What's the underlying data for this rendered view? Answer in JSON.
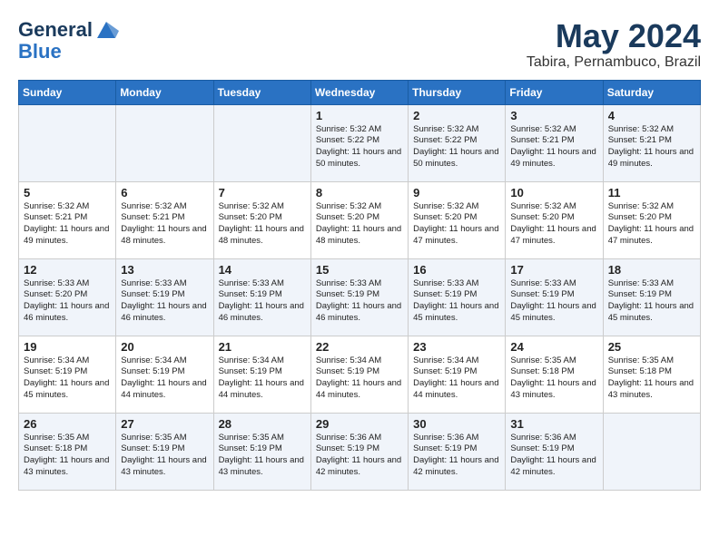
{
  "header": {
    "logo_line1": "General",
    "logo_line2": "Blue",
    "month": "May 2024",
    "location": "Tabira, Pernambuco, Brazil"
  },
  "days_of_week": [
    "Sunday",
    "Monday",
    "Tuesday",
    "Wednesday",
    "Thursday",
    "Friday",
    "Saturday"
  ],
  "weeks": [
    [
      {
        "day": "",
        "content": ""
      },
      {
        "day": "",
        "content": ""
      },
      {
        "day": "",
        "content": ""
      },
      {
        "day": "1",
        "content": "Sunrise: 5:32 AM\nSunset: 5:22 PM\nDaylight: 11 hours\nand 50 minutes."
      },
      {
        "day": "2",
        "content": "Sunrise: 5:32 AM\nSunset: 5:22 PM\nDaylight: 11 hours\nand 50 minutes."
      },
      {
        "day": "3",
        "content": "Sunrise: 5:32 AM\nSunset: 5:21 PM\nDaylight: 11 hours\nand 49 minutes."
      },
      {
        "day": "4",
        "content": "Sunrise: 5:32 AM\nSunset: 5:21 PM\nDaylight: 11 hours\nand 49 minutes."
      }
    ],
    [
      {
        "day": "5",
        "content": "Sunrise: 5:32 AM\nSunset: 5:21 PM\nDaylight: 11 hours\nand 49 minutes."
      },
      {
        "day": "6",
        "content": "Sunrise: 5:32 AM\nSunset: 5:21 PM\nDaylight: 11 hours\nand 48 minutes."
      },
      {
        "day": "7",
        "content": "Sunrise: 5:32 AM\nSunset: 5:20 PM\nDaylight: 11 hours\nand 48 minutes."
      },
      {
        "day": "8",
        "content": "Sunrise: 5:32 AM\nSunset: 5:20 PM\nDaylight: 11 hours\nand 48 minutes."
      },
      {
        "day": "9",
        "content": "Sunrise: 5:32 AM\nSunset: 5:20 PM\nDaylight: 11 hours\nand 47 minutes."
      },
      {
        "day": "10",
        "content": "Sunrise: 5:32 AM\nSunset: 5:20 PM\nDaylight: 11 hours\nand 47 minutes."
      },
      {
        "day": "11",
        "content": "Sunrise: 5:32 AM\nSunset: 5:20 PM\nDaylight: 11 hours\nand 47 minutes."
      }
    ],
    [
      {
        "day": "12",
        "content": "Sunrise: 5:33 AM\nSunset: 5:20 PM\nDaylight: 11 hours\nand 46 minutes."
      },
      {
        "day": "13",
        "content": "Sunrise: 5:33 AM\nSunset: 5:19 PM\nDaylight: 11 hours\nand 46 minutes."
      },
      {
        "day": "14",
        "content": "Sunrise: 5:33 AM\nSunset: 5:19 PM\nDaylight: 11 hours\nand 46 minutes."
      },
      {
        "day": "15",
        "content": "Sunrise: 5:33 AM\nSunset: 5:19 PM\nDaylight: 11 hours\nand 46 minutes."
      },
      {
        "day": "16",
        "content": "Sunrise: 5:33 AM\nSunset: 5:19 PM\nDaylight: 11 hours\nand 45 minutes."
      },
      {
        "day": "17",
        "content": "Sunrise: 5:33 AM\nSunset: 5:19 PM\nDaylight: 11 hours\nand 45 minutes."
      },
      {
        "day": "18",
        "content": "Sunrise: 5:33 AM\nSunset: 5:19 PM\nDaylight: 11 hours\nand 45 minutes."
      }
    ],
    [
      {
        "day": "19",
        "content": "Sunrise: 5:34 AM\nSunset: 5:19 PM\nDaylight: 11 hours\nand 45 minutes."
      },
      {
        "day": "20",
        "content": "Sunrise: 5:34 AM\nSunset: 5:19 PM\nDaylight: 11 hours\nand 44 minutes."
      },
      {
        "day": "21",
        "content": "Sunrise: 5:34 AM\nSunset: 5:19 PM\nDaylight: 11 hours\nand 44 minutes."
      },
      {
        "day": "22",
        "content": "Sunrise: 5:34 AM\nSunset: 5:19 PM\nDaylight: 11 hours\nand 44 minutes."
      },
      {
        "day": "23",
        "content": "Sunrise: 5:34 AM\nSunset: 5:19 PM\nDaylight: 11 hours\nand 44 minutes."
      },
      {
        "day": "24",
        "content": "Sunrise: 5:35 AM\nSunset: 5:18 PM\nDaylight: 11 hours\nand 43 minutes."
      },
      {
        "day": "25",
        "content": "Sunrise: 5:35 AM\nSunset: 5:18 PM\nDaylight: 11 hours\nand 43 minutes."
      }
    ],
    [
      {
        "day": "26",
        "content": "Sunrise: 5:35 AM\nSunset: 5:18 PM\nDaylight: 11 hours\nand 43 minutes."
      },
      {
        "day": "27",
        "content": "Sunrise: 5:35 AM\nSunset: 5:19 PM\nDaylight: 11 hours\nand 43 minutes."
      },
      {
        "day": "28",
        "content": "Sunrise: 5:35 AM\nSunset: 5:19 PM\nDaylight: 11 hours\nand 43 minutes."
      },
      {
        "day": "29",
        "content": "Sunrise: 5:36 AM\nSunset: 5:19 PM\nDaylight: 11 hours\nand 42 minutes."
      },
      {
        "day": "30",
        "content": "Sunrise: 5:36 AM\nSunset: 5:19 PM\nDaylight: 11 hours\nand 42 minutes."
      },
      {
        "day": "31",
        "content": "Sunrise: 5:36 AM\nSunset: 5:19 PM\nDaylight: 11 hours\nand 42 minutes."
      },
      {
        "day": "",
        "content": ""
      }
    ]
  ]
}
